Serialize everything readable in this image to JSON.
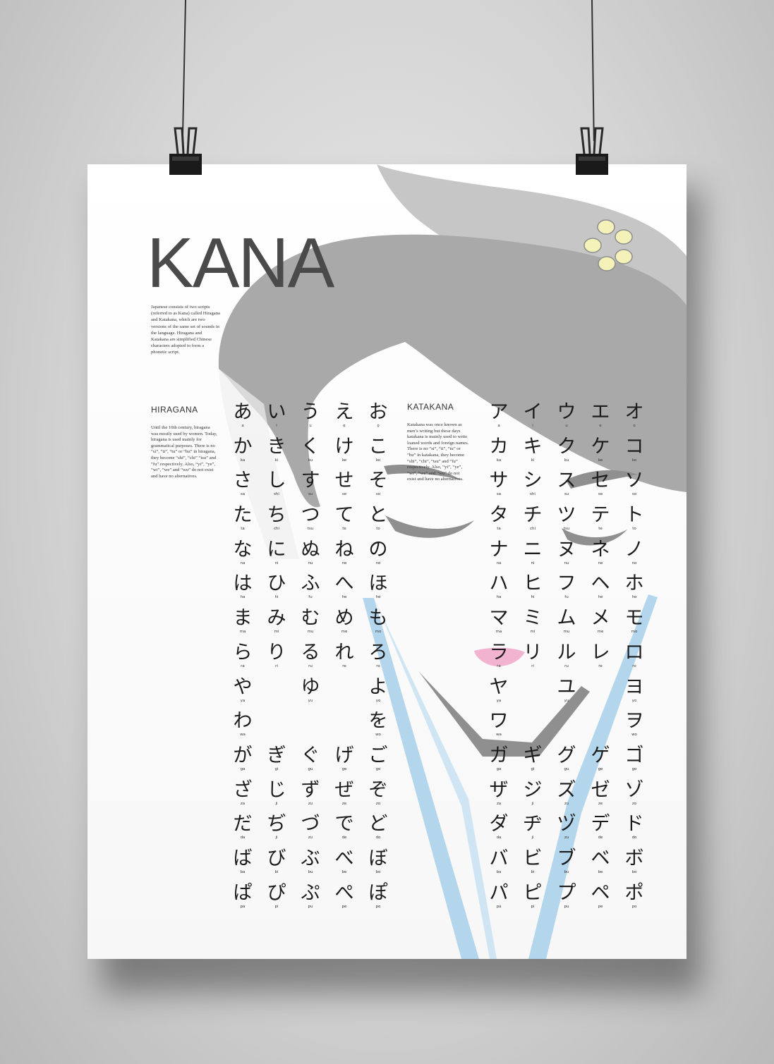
{
  "poster": {
    "title": "KANA",
    "intro": "Japanese consists of two scripts (referred to as Kana) called Hiragana and Katakana, which are two versions of the same set of sounds in the language. Hiragana and Katakana are simplified Chinese characters adopted to form a phonetic script.",
    "hiragana_heading": "HIRAGANA",
    "hiragana_text": "Until the 10th century, hiragana was mostly used by women. Today, hiragana is used mainly for grammatical purposes. There is no “si”, “ti”, “tu” or “hu” in hiragana, they become “shi”, “chi” “tsu” and “fu” respectively. Also, “yi”, “ye”, “wi”, “we” and “wu” do not exist and have no alternatives.",
    "katakana_heading": "KATAKANA",
    "katakana_text": "Katakana was once known as men’s writing but these days katakana is mainly used to write loaned words and foreign names. There is no “si”, “ti”, “tu” or “hu” in katakana, they become “shi”, “chi”, “tsu” and “fu” respectively. Also, “yi”, “ye”, “wi”, “we” and “wu” do not exist and have no alternatives."
  },
  "colors": {
    "hair": "#a9a9a9",
    "hair_light": "#c6c6c6",
    "flower": "#f4f1b9",
    "collar": "#b3d6ec",
    "lips": "#f1b3cf",
    "features": "#8f8f8f",
    "text": "#1c1c1c",
    "title": "#4a4a4a"
  },
  "hiragana": [
    [
      {
        "k": "あ",
        "r": "a"
      },
      {
        "k": "い",
        "r": "i"
      },
      {
        "k": "う",
        "r": "u"
      },
      {
        "k": "え",
        "r": "e"
      },
      {
        "k": "お",
        "r": "o"
      }
    ],
    [
      {
        "k": "か",
        "r": "ka"
      },
      {
        "k": "き",
        "r": "ki"
      },
      {
        "k": "く",
        "r": "ku"
      },
      {
        "k": "け",
        "r": "ke"
      },
      {
        "k": "こ",
        "r": "ko"
      }
    ],
    [
      {
        "k": "さ",
        "r": "sa"
      },
      {
        "k": "し",
        "r": "shi"
      },
      {
        "k": "す",
        "r": "su"
      },
      {
        "k": "せ",
        "r": "se"
      },
      {
        "k": "そ",
        "r": "so"
      }
    ],
    [
      {
        "k": "た",
        "r": "ta"
      },
      {
        "k": "ち",
        "r": "chi"
      },
      {
        "k": "つ",
        "r": "tsu"
      },
      {
        "k": "て",
        "r": "te"
      },
      {
        "k": "と",
        "r": "to"
      }
    ],
    [
      {
        "k": "な",
        "r": "na"
      },
      {
        "k": "に",
        "r": "ni"
      },
      {
        "k": "ぬ",
        "r": "nu"
      },
      {
        "k": "ね",
        "r": "ne"
      },
      {
        "k": "の",
        "r": "no"
      }
    ],
    [
      {
        "k": "は",
        "r": "ha"
      },
      {
        "k": "ひ",
        "r": "hi"
      },
      {
        "k": "ふ",
        "r": "fu"
      },
      {
        "k": "へ",
        "r": "he"
      },
      {
        "k": "ほ",
        "r": "ho"
      }
    ],
    [
      {
        "k": "ま",
        "r": "ma"
      },
      {
        "k": "み",
        "r": "mi"
      },
      {
        "k": "む",
        "r": "mu"
      },
      {
        "k": "め",
        "r": "me"
      },
      {
        "k": "も",
        "r": "mo"
      }
    ],
    [
      {
        "k": "ら",
        "r": "ra"
      },
      {
        "k": "り",
        "r": "ri"
      },
      {
        "k": "る",
        "r": "ru"
      },
      {
        "k": "れ",
        "r": "re"
      },
      {
        "k": "ろ",
        "r": "ro"
      }
    ],
    [
      {
        "k": "や",
        "r": "ya"
      },
      {
        "k": "",
        "r": ""
      },
      {
        "k": "ゆ",
        "r": "yu"
      },
      {
        "k": "",
        "r": ""
      },
      {
        "k": "よ",
        "r": "yo"
      }
    ],
    [
      {
        "k": "わ",
        "r": "wa"
      },
      {
        "k": "",
        "r": ""
      },
      {
        "k": "",
        "r": ""
      },
      {
        "k": "",
        "r": ""
      },
      {
        "k": "を",
        "r": "wo"
      }
    ],
    [
      {
        "k": "が",
        "r": "ga"
      },
      {
        "k": "ぎ",
        "r": "gi"
      },
      {
        "k": "ぐ",
        "r": "gu"
      },
      {
        "k": "げ",
        "r": "ge"
      },
      {
        "k": "ご",
        "r": "go"
      }
    ],
    [
      {
        "k": "ざ",
        "r": "za"
      },
      {
        "k": "じ",
        "r": "ji"
      },
      {
        "k": "ず",
        "r": "zu"
      },
      {
        "k": "ぜ",
        "r": "ze"
      },
      {
        "k": "ぞ",
        "r": "zo"
      }
    ],
    [
      {
        "k": "だ",
        "r": "da"
      },
      {
        "k": "ぢ",
        "r": "ji"
      },
      {
        "k": "づ",
        "r": "zu"
      },
      {
        "k": "で",
        "r": "de"
      },
      {
        "k": "ど",
        "r": "do"
      }
    ],
    [
      {
        "k": "ば",
        "r": "ba"
      },
      {
        "k": "び",
        "r": "bi"
      },
      {
        "k": "ぶ",
        "r": "bu"
      },
      {
        "k": "べ",
        "r": "be"
      },
      {
        "k": "ぼ",
        "r": "bo"
      }
    ],
    [
      {
        "k": "ぱ",
        "r": "pa"
      },
      {
        "k": "ぴ",
        "r": "pi"
      },
      {
        "k": "ぷ",
        "r": "pu"
      },
      {
        "k": "ぺ",
        "r": "pe"
      },
      {
        "k": "ぽ",
        "r": "po"
      }
    ]
  ],
  "katakana": [
    [
      {
        "k": "ア",
        "r": "a"
      },
      {
        "k": "イ",
        "r": "i"
      },
      {
        "k": "ウ",
        "r": "u"
      },
      {
        "k": "エ",
        "r": "e"
      },
      {
        "k": "オ",
        "r": "o"
      }
    ],
    [
      {
        "k": "カ",
        "r": "ka"
      },
      {
        "k": "キ",
        "r": "ki"
      },
      {
        "k": "ク",
        "r": "ku"
      },
      {
        "k": "ケ",
        "r": "ke"
      },
      {
        "k": "コ",
        "r": "ko"
      }
    ],
    [
      {
        "k": "サ",
        "r": "sa"
      },
      {
        "k": "シ",
        "r": "shi"
      },
      {
        "k": "ス",
        "r": "su"
      },
      {
        "k": "セ",
        "r": "se"
      },
      {
        "k": "ソ",
        "r": "so"
      }
    ],
    [
      {
        "k": "タ",
        "r": "ta"
      },
      {
        "k": "チ",
        "r": "chi"
      },
      {
        "k": "ツ",
        "r": "tsu"
      },
      {
        "k": "テ",
        "r": "te"
      },
      {
        "k": "ト",
        "r": "to"
      }
    ],
    [
      {
        "k": "ナ",
        "r": "na"
      },
      {
        "k": "ニ",
        "r": "ni"
      },
      {
        "k": "ヌ",
        "r": "nu"
      },
      {
        "k": "ネ",
        "r": "ne"
      },
      {
        "k": "ノ",
        "r": "no"
      }
    ],
    [
      {
        "k": "ハ",
        "r": "ha"
      },
      {
        "k": "ヒ",
        "r": "hi"
      },
      {
        "k": "フ",
        "r": "fu"
      },
      {
        "k": "ヘ",
        "r": "he"
      },
      {
        "k": "ホ",
        "r": "ho"
      }
    ],
    [
      {
        "k": "マ",
        "r": "ma"
      },
      {
        "k": "ミ",
        "r": "mi"
      },
      {
        "k": "ム",
        "r": "mu"
      },
      {
        "k": "メ",
        "r": "me"
      },
      {
        "k": "モ",
        "r": "mo"
      }
    ],
    [
      {
        "k": "ラ",
        "r": "ra"
      },
      {
        "k": "リ",
        "r": "ri"
      },
      {
        "k": "ル",
        "r": "ru"
      },
      {
        "k": "レ",
        "r": "re"
      },
      {
        "k": "ロ",
        "r": "ro"
      }
    ],
    [
      {
        "k": "ヤ",
        "r": "ya"
      },
      {
        "k": "",
        "r": ""
      },
      {
        "k": "ユ",
        "r": "yu"
      },
      {
        "k": "",
        "r": ""
      },
      {
        "k": "ヨ",
        "r": "yo"
      }
    ],
    [
      {
        "k": "ワ",
        "r": "wa"
      },
      {
        "k": "",
        "r": ""
      },
      {
        "k": "",
        "r": ""
      },
      {
        "k": "",
        "r": ""
      },
      {
        "k": "ヲ",
        "r": "wo"
      }
    ],
    [
      {
        "k": "ガ",
        "r": "ga"
      },
      {
        "k": "ギ",
        "r": "gi"
      },
      {
        "k": "グ",
        "r": "gu"
      },
      {
        "k": "ゲ",
        "r": "ge"
      },
      {
        "k": "ゴ",
        "r": "go"
      }
    ],
    [
      {
        "k": "ザ",
        "r": "za"
      },
      {
        "k": "ジ",
        "r": "ji"
      },
      {
        "k": "ズ",
        "r": "zu"
      },
      {
        "k": "ゼ",
        "r": "ze"
      },
      {
        "k": "ゾ",
        "r": "zo"
      }
    ],
    [
      {
        "k": "ダ",
        "r": "da"
      },
      {
        "k": "ヂ",
        "r": "ji"
      },
      {
        "k": "ヅ",
        "r": "zu"
      },
      {
        "k": "デ",
        "r": "de"
      },
      {
        "k": "ド",
        "r": "do"
      }
    ],
    [
      {
        "k": "バ",
        "r": "ba"
      },
      {
        "k": "ビ",
        "r": "bi"
      },
      {
        "k": "ブ",
        "r": "bu"
      },
      {
        "k": "ベ",
        "r": "be"
      },
      {
        "k": "ボ",
        "r": "bo"
      }
    ],
    [
      {
        "k": "パ",
        "r": "pa"
      },
      {
        "k": "ピ",
        "r": "pi"
      },
      {
        "k": "プ",
        "r": "pu"
      },
      {
        "k": "ペ",
        "r": "pe"
      },
      {
        "k": "ポ",
        "r": "po"
      }
    ]
  ]
}
